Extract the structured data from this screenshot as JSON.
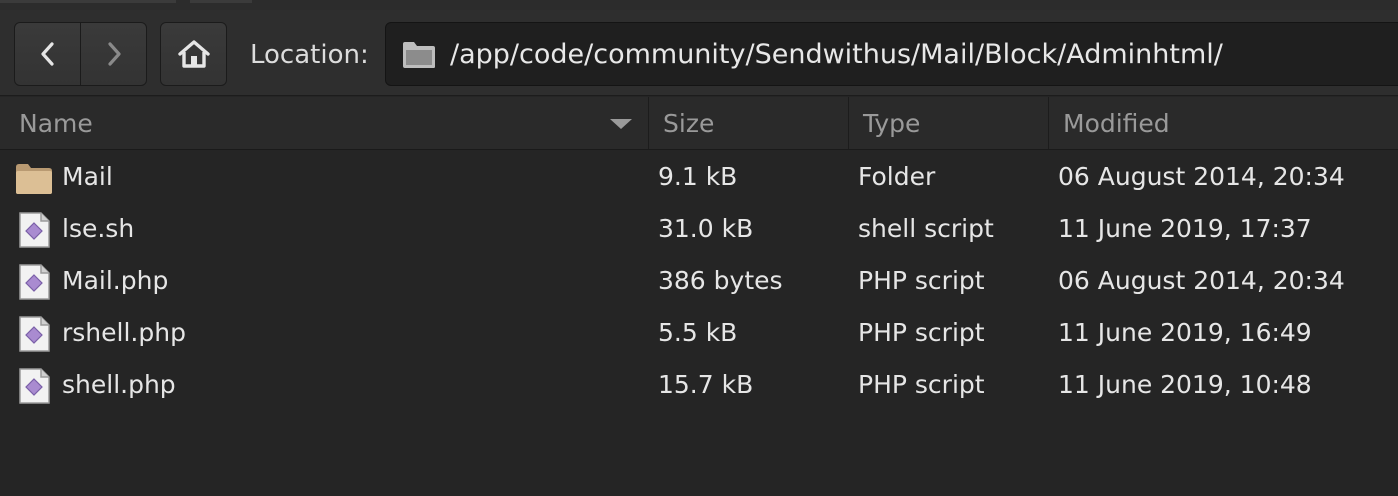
{
  "navigation": {
    "back_icon": "chevron-left-icon",
    "forward_icon": "chevron-right-icon",
    "home_icon": "home-icon"
  },
  "location": {
    "label": "Location:",
    "path": "/app/code/community/Sendwithus/Mail/Block/Adminhtml/"
  },
  "columns": {
    "name": "Name",
    "size": "Size",
    "type": "Type",
    "modified": "Modified"
  },
  "files": [
    {
      "name": "Mail",
      "size": "9.1 kB",
      "type": "Folder",
      "modified": "06 August 2014, 20:34",
      "icon": "folder-icon"
    },
    {
      "name": "lse.sh",
      "size": "31.0 kB",
      "type": "shell script",
      "modified": "11 June 2019, 17:37",
      "icon": "script-file-icon"
    },
    {
      "name": "Mail.php",
      "size": "386 bytes",
      "type": "PHP script",
      "modified": "06 August 2014, 20:34",
      "icon": "script-file-icon"
    },
    {
      "name": "rshell.php",
      "size": "5.5 kB",
      "type": "PHP script",
      "modified": "11 June 2019, 16:49",
      "icon": "script-file-icon"
    },
    {
      "name": "shell.php",
      "size": "15.7 kB",
      "type": "PHP script",
      "modified": "11 June 2019, 10:48",
      "icon": "script-file-icon"
    }
  ]
}
